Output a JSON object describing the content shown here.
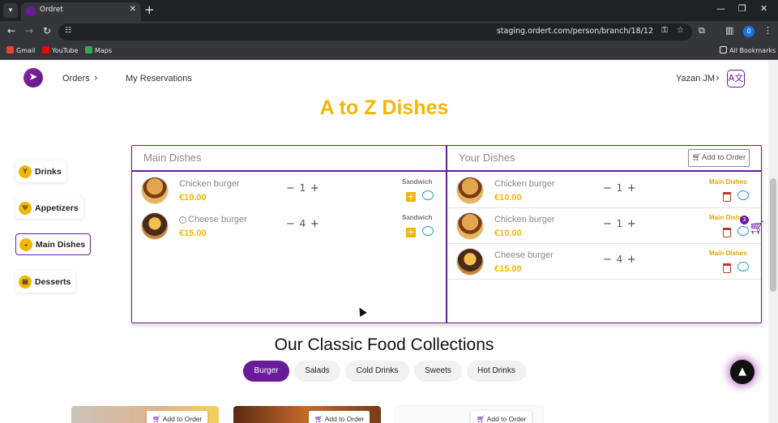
{
  "browser": {
    "tab_title": "Ordret",
    "tab_close": "✕",
    "new_tab": "+",
    "url": "staging.ordert.com/person/branch/18/12",
    "profile_initial": "0",
    "bookmarks": [
      {
        "label": "Gmail",
        "color": "#ea4335"
      },
      {
        "label": "YouTube",
        "color": "#ff0000"
      },
      {
        "label": "Maps",
        "color": "#34a853"
      }
    ],
    "all_bookmarks": "All Bookmarks"
  },
  "header": {
    "nav_orders": "Orders",
    "nav_reservations": "My Reservations",
    "user_name": "Yazan JM",
    "chevron": "›"
  },
  "page_title": "A to Z Dishes",
  "categories": [
    {
      "label": "Drinks",
      "icon": "cocktail-icon",
      "glyph": "Y"
    },
    {
      "label": "Appetizers",
      "icon": "cutlery-icon",
      "glyph": "Ψ"
    },
    {
      "label": "Main Dishes",
      "icon": "cloche-icon",
      "glyph": "◒"
    },
    {
      "label": "Desserts",
      "icon": "cake-icon",
      "glyph": "▤"
    }
  ],
  "main_dishes": {
    "title": "Main Dishes",
    "items": [
      {
        "name": "Chicken burger",
        "price": "€10.00",
        "qty": "1",
        "category": "Sandwich"
      },
      {
        "name": "Cheese burger",
        "price": "€15.00",
        "qty": "4",
        "category": "Sandwich"
      }
    ]
  },
  "your_dishes": {
    "title": "Your Dishes",
    "add_to_order": "Add to Order",
    "items": [
      {
        "name": "Chicken burger",
        "price": "€10.00",
        "qty": "1",
        "category": "Main Dishes"
      },
      {
        "name": "Chicken burger",
        "price": "€10.00",
        "qty": "1",
        "category": "Main Dishes"
      },
      {
        "name": "Cheese burger",
        "price": "€15.00",
        "qty": "4",
        "category": "Main Dishes"
      }
    ]
  },
  "cart_count": "3",
  "collections": {
    "title": "Our Classic Food Collections",
    "tabs": [
      "Burger",
      "Salads",
      "Cold Drinks",
      "Sweets",
      "Hot Drinks"
    ],
    "active_tab": "Burger",
    "card_button": "Add to Order"
  },
  "colors": {
    "brand": "#6a1b9a",
    "accent": "#f2b705",
    "chat": "#2a9ad6",
    "trash": "#c0392b"
  }
}
